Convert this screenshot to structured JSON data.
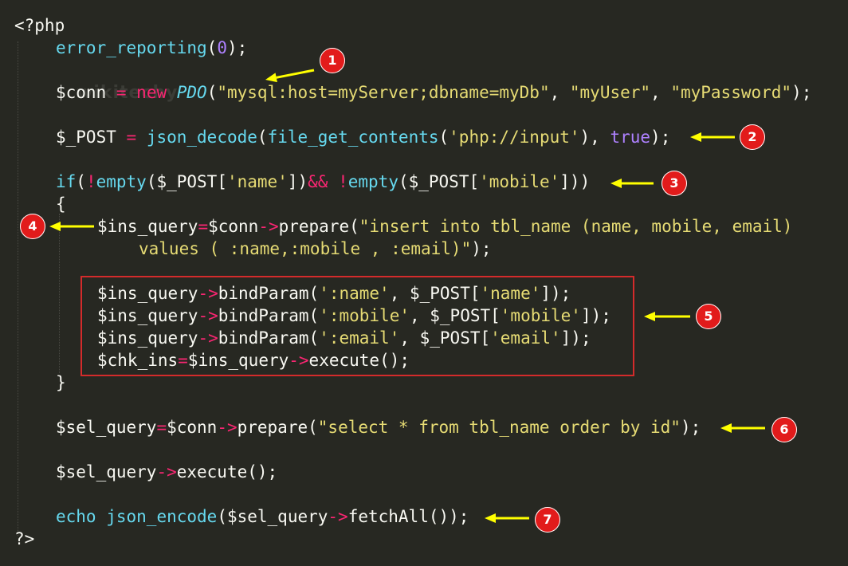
{
  "watermark": "wikitechy",
  "colors": {
    "background": "#272822",
    "default": "#f8f8f2",
    "function": "#66d9ef",
    "keyword": "#f92672",
    "string": "#e6db74",
    "constant": "#ae81ff",
    "class": "#a6e22e",
    "annotation": "#e21b1b",
    "arrow": "#ffff00"
  },
  "code_lines": [
    {
      "indent": 0,
      "tokens": [
        {
          "t": "<?php",
          "c": "default"
        }
      ]
    },
    {
      "indent": 1,
      "tokens": [
        {
          "t": "error_reporting",
          "c": "function"
        },
        {
          "t": "(",
          "c": "default"
        },
        {
          "t": "0",
          "c": "constant"
        },
        {
          "t": ");",
          "c": "default"
        }
      ]
    },
    {
      "indent": 1,
      "tokens": [
        {
          "t": "$conn ",
          "c": "default"
        },
        {
          "t": "=",
          "c": "keyword"
        },
        {
          "t": " ",
          "c": "default"
        },
        {
          "t": "new",
          "c": "keyword"
        },
        {
          "t": " ",
          "c": "default"
        },
        {
          "t": "PDO",
          "c": "function",
          "italic": true
        },
        {
          "t": "(",
          "c": "default"
        },
        {
          "t": "\"mysql:host=myServer;dbname=myDb\"",
          "c": "string"
        },
        {
          "t": ", ",
          "c": "default"
        },
        {
          "t": "\"myUser\"",
          "c": "string"
        },
        {
          "t": ", ",
          "c": "default"
        },
        {
          "t": "\"myPassword\"",
          "c": "string"
        },
        {
          "t": ");",
          "c": "default"
        }
      ]
    },
    {
      "indent": 1,
      "tokens": [
        {
          "t": "$_POST ",
          "c": "default"
        },
        {
          "t": "=",
          "c": "keyword"
        },
        {
          "t": " ",
          "c": "default"
        },
        {
          "t": "json_decode",
          "c": "function"
        },
        {
          "t": "(",
          "c": "default"
        },
        {
          "t": "file_get_contents",
          "c": "function"
        },
        {
          "t": "(",
          "c": "default"
        },
        {
          "t": "'php://input'",
          "c": "string"
        },
        {
          "t": "), ",
          "c": "default"
        },
        {
          "t": "true",
          "c": "constant"
        },
        {
          "t": ");",
          "c": "default"
        }
      ]
    },
    {
      "indent": 1,
      "tokens": [
        {
          "t": "if",
          "c": "function"
        },
        {
          "t": "(",
          "c": "default"
        },
        {
          "t": "!",
          "c": "keyword"
        },
        {
          "t": "empty",
          "c": "function"
        },
        {
          "t": "($_POST[",
          "c": "default"
        },
        {
          "t": "'name'",
          "c": "string"
        },
        {
          "t": "])",
          "c": "default"
        },
        {
          "t": "&&",
          "c": "keyword"
        },
        {
          "t": " ",
          "c": "default"
        },
        {
          "t": "!",
          "c": "keyword"
        },
        {
          "t": "empty",
          "c": "function"
        },
        {
          "t": "($_POST[",
          "c": "default"
        },
        {
          "t": "'mobile'",
          "c": "string"
        },
        {
          "t": "]))",
          "c": "default"
        }
      ]
    },
    {
      "indent": 1,
      "tokens": [
        {
          "t": "{",
          "c": "default"
        }
      ]
    },
    {
      "indent": 2,
      "tokens": [
        {
          "t": "$ins_query",
          "c": "default"
        },
        {
          "t": "=",
          "c": "keyword"
        },
        {
          "t": "$conn",
          "c": "default"
        },
        {
          "t": "->",
          "c": "keyword"
        },
        {
          "t": "prepare",
          "c": "default"
        },
        {
          "t": "(",
          "c": "default"
        },
        {
          "t": "\"insert into tbl_name (name, mobile, email)",
          "c": "string"
        }
      ]
    },
    {
      "indent": 3,
      "tokens": [
        {
          "t": "values ( :name,:mobile , :email)\"",
          "c": "string"
        },
        {
          "t": ");",
          "c": "default"
        }
      ]
    },
    {
      "indent": 2,
      "tokens": [
        {
          "t": "$ins_query",
          "c": "default"
        },
        {
          "t": "->",
          "c": "keyword"
        },
        {
          "t": "bindParam",
          "c": "default"
        },
        {
          "t": "(",
          "c": "default"
        },
        {
          "t": "':name'",
          "c": "string"
        },
        {
          "t": ", $_POST[",
          "c": "default"
        },
        {
          "t": "'name'",
          "c": "string"
        },
        {
          "t": "]);",
          "c": "default"
        }
      ]
    },
    {
      "indent": 2,
      "tokens": [
        {
          "t": "$ins_query",
          "c": "default"
        },
        {
          "t": "->",
          "c": "keyword"
        },
        {
          "t": "bindParam",
          "c": "default"
        },
        {
          "t": "(",
          "c": "default"
        },
        {
          "t": "':mobile'",
          "c": "string"
        },
        {
          "t": ", $_POST[",
          "c": "default"
        },
        {
          "t": "'mobile'",
          "c": "string"
        },
        {
          "t": "]);",
          "c": "default"
        }
      ]
    },
    {
      "indent": 2,
      "tokens": [
        {
          "t": "$ins_query",
          "c": "default"
        },
        {
          "t": "->",
          "c": "keyword"
        },
        {
          "t": "bindParam",
          "c": "default"
        },
        {
          "t": "(",
          "c": "default"
        },
        {
          "t": "':email'",
          "c": "string"
        },
        {
          "t": ", $_POST[",
          "c": "default"
        },
        {
          "t": "'email'",
          "c": "string"
        },
        {
          "t": "]);",
          "c": "default"
        }
      ]
    },
    {
      "indent": 2,
      "tokens": [
        {
          "t": "$chk_ins",
          "c": "default"
        },
        {
          "t": "=",
          "c": "keyword"
        },
        {
          "t": "$ins_query",
          "c": "default"
        },
        {
          "t": "->",
          "c": "keyword"
        },
        {
          "t": "execute",
          "c": "default"
        },
        {
          "t": "();",
          "c": "default"
        }
      ]
    },
    {
      "indent": 1,
      "tokens": [
        {
          "t": "}",
          "c": "default"
        }
      ]
    },
    {
      "indent": 1,
      "tokens": [
        {
          "t": "$sel_query",
          "c": "default"
        },
        {
          "t": "=",
          "c": "keyword"
        },
        {
          "t": "$conn",
          "c": "default"
        },
        {
          "t": "->",
          "c": "keyword"
        },
        {
          "t": "prepare",
          "c": "default"
        },
        {
          "t": "(",
          "c": "default"
        },
        {
          "t": "\"select * from tbl_name order by id\"",
          "c": "string"
        },
        {
          "t": ");",
          "c": "default"
        }
      ]
    },
    {
      "indent": 1,
      "tokens": [
        {
          "t": "$sel_query",
          "c": "default"
        },
        {
          "t": "->",
          "c": "keyword"
        },
        {
          "t": "execute",
          "c": "default"
        },
        {
          "t": "();",
          "c": "default"
        }
      ]
    },
    {
      "indent": 1,
      "tokens": [
        {
          "t": "echo",
          "c": "function"
        },
        {
          "t": " ",
          "c": "default"
        },
        {
          "t": "json_encode",
          "c": "function"
        },
        {
          "t": "($sel_query",
          "c": "default"
        },
        {
          "t": "->",
          "c": "keyword"
        },
        {
          "t": "fetchAll",
          "c": "default"
        },
        {
          "t": "());",
          "c": "default"
        }
      ]
    },
    {
      "indent": 0,
      "tokens": [
        {
          "t": "?>",
          "c": "default"
        }
      ]
    }
  ],
  "annotations": [
    {
      "number": "1"
    },
    {
      "number": "2"
    },
    {
      "number": "3"
    },
    {
      "number": "4"
    },
    {
      "number": "5"
    },
    {
      "number": "6"
    },
    {
      "number": "7"
    }
  ]
}
